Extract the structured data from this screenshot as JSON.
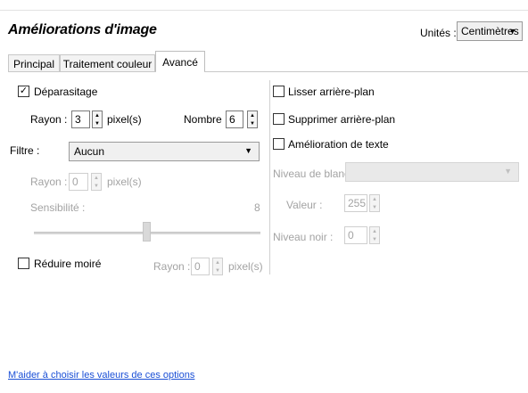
{
  "header": {
    "title": "Améliorations d'image",
    "units_label": "Unités :",
    "units_value": "Centimètres"
  },
  "tabs": [
    {
      "label": "Principal",
      "active": false
    },
    {
      "label": "Traitement couleur",
      "active": false
    },
    {
      "label": "Avancé",
      "active": true
    }
  ],
  "left": {
    "despeckle": {
      "label": "Déparasitage",
      "checked": true
    },
    "radius": {
      "label": "Rayon :",
      "value": "3",
      "unit": "pixel(s)"
    },
    "count": {
      "label": "Nombre :",
      "value": "6"
    },
    "filter": {
      "label": "Filtre :",
      "value": "Aucun"
    },
    "filter_radius": {
      "label": "Rayon :",
      "value": "0",
      "unit": "pixel(s)"
    },
    "sensitivity": {
      "label": "Sensibilité :",
      "value": "8",
      "slider_fraction": 0.5
    },
    "moire": {
      "label": "Réduire moiré",
      "checked": false
    },
    "moire_radius": {
      "label": "Rayon :",
      "value": "0",
      "unit": "pixel(s)"
    }
  },
  "right": {
    "smooth_background": {
      "label": "Lisser arrière-plan",
      "checked": false
    },
    "remove_background": {
      "label": "Supprimer arrière-plan",
      "checked": false
    },
    "text_enhance": {
      "label": "Amélioration de texte",
      "checked": false
    },
    "white_level": {
      "label": "Niveau de blanc :",
      "value": ""
    },
    "white_value": {
      "label": "Valeur :",
      "value": "255"
    },
    "black_level": {
      "label": "Niveau noir :",
      "value": "0"
    }
  },
  "help_link": "M'aider à choisir les valeurs de ces options",
  "icons": {
    "check": "✓",
    "arrow_down": "▼",
    "spin_up": "▲",
    "spin_down": "▼"
  }
}
